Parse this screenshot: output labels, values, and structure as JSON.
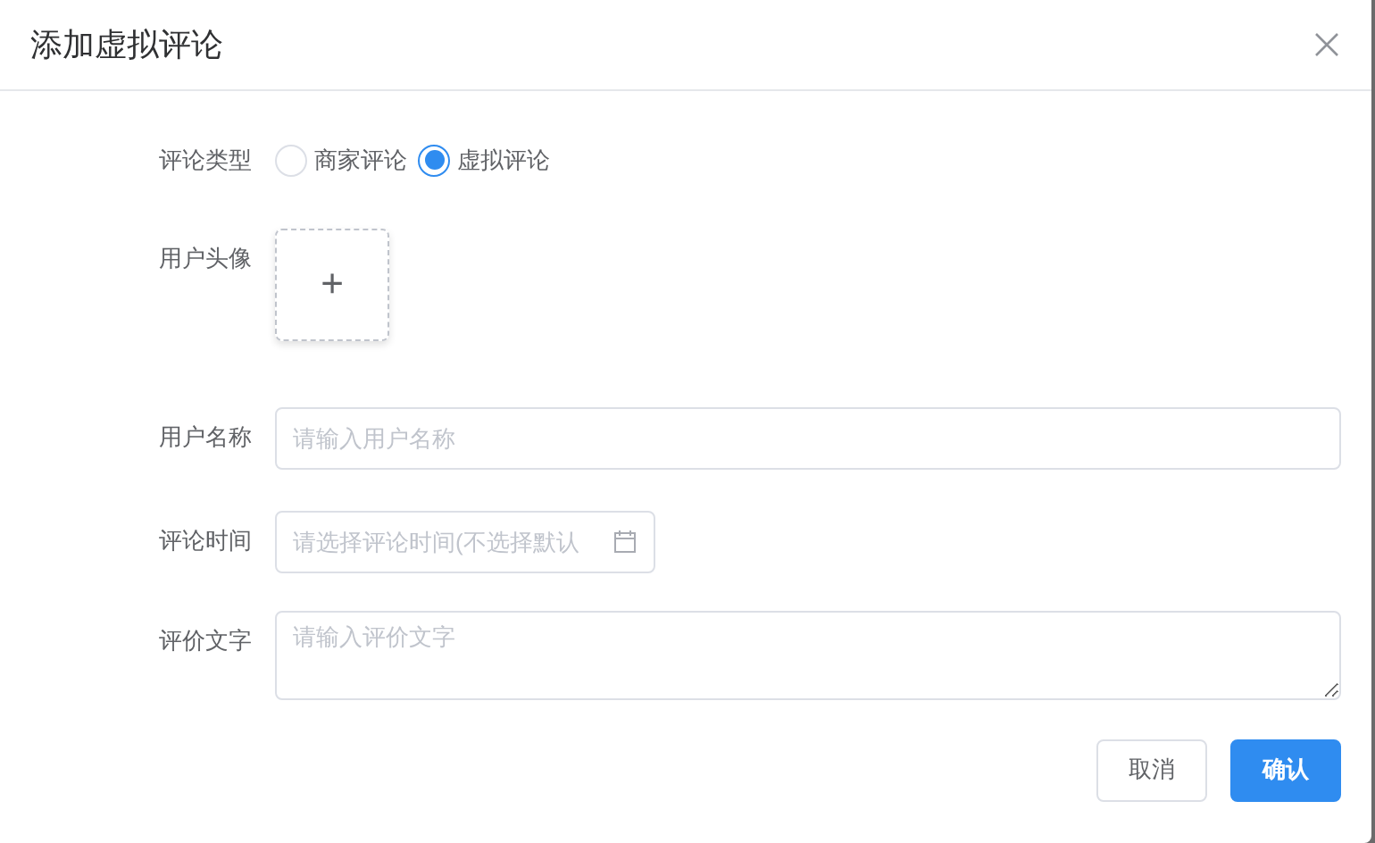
{
  "dialog": {
    "title": "添加虚拟评论"
  },
  "fields": [
    {
      "kind": "radio",
      "label": "评论类型",
      "options": [
        {
          "label": "商家评论",
          "selected": false
        },
        {
          "label": "虚拟评论",
          "selected": true
        }
      ]
    },
    {
      "kind": "upload",
      "label": "用户头像",
      "icon_text": "+"
    },
    {
      "kind": "text",
      "label": "用户名称",
      "placeholder": "请输入用户名称"
    },
    {
      "kind": "date",
      "label": "评论时间",
      "placeholder": "请选择评论时间(不选择默认"
    },
    {
      "kind": "textarea",
      "label": "评价文字",
      "placeholder": "请输入评价文字"
    }
  ],
  "buttons": [
    {
      "label": "取消",
      "kind": "default"
    },
    {
      "label": "确认",
      "kind": "primary"
    }
  ]
}
